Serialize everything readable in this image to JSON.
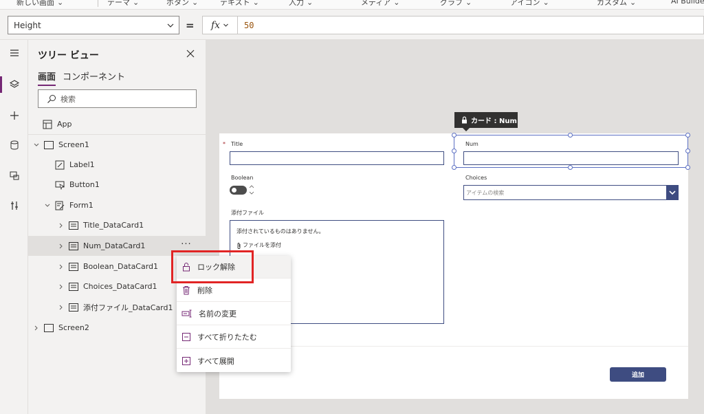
{
  "ribbon": {
    "items": [
      "新しい画面",
      "テーマ",
      "ボタン",
      "テキスト",
      "入力",
      "メディア",
      "グラフ",
      "アイコン",
      "カスタム",
      "AI Builder"
    ]
  },
  "formula": {
    "property": "Height",
    "equals": "=",
    "fx_label": "fx",
    "value": "50"
  },
  "tree": {
    "title": "ツリー ビュー",
    "tabs": [
      "画面",
      "コンポーネント"
    ],
    "search_placeholder": "検索",
    "app_label": "App",
    "nodes": [
      {
        "label": "Screen1"
      },
      {
        "label": "Label1"
      },
      {
        "label": "Button1"
      },
      {
        "label": "Form1"
      },
      {
        "label": "Title_DataCard1"
      },
      {
        "label": "Num_DataCard1"
      },
      {
        "label": "Boolean_DataCard1"
      },
      {
        "label": "Choices_DataCard1"
      },
      {
        "label": "添付ファイル_DataCard1"
      },
      {
        "label": "Screen2"
      }
    ],
    "more": "···"
  },
  "context_menu": {
    "items": [
      {
        "label": "ロック解除",
        "icon": "unlock-icon"
      },
      {
        "label": "削除",
        "icon": "trash-icon"
      },
      {
        "label": "名前の変更",
        "icon": "rename-icon"
      },
      {
        "label": "すべて折りたたむ",
        "icon": "collapse-all-icon"
      },
      {
        "label": "すべて展開",
        "icon": "expand-all-icon"
      }
    ]
  },
  "canvas": {
    "tooltip": "カード : Num",
    "form": {
      "title_label": "Title",
      "required_mark": "*",
      "num_label": "Num",
      "boolean_label": "Boolean",
      "choices_label": "Choices",
      "choices_placeholder": "アイテムの検索",
      "attach_label": "添付ファイル",
      "attach_empty": "添付されているものはありません。",
      "attach_link": "ファイルを添付"
    },
    "add_button": "追加"
  },
  "colors": {
    "accent": "#742774",
    "form_accent": "#3e4c81",
    "highlight": "#e12424",
    "selection": "#5b6fc2"
  }
}
